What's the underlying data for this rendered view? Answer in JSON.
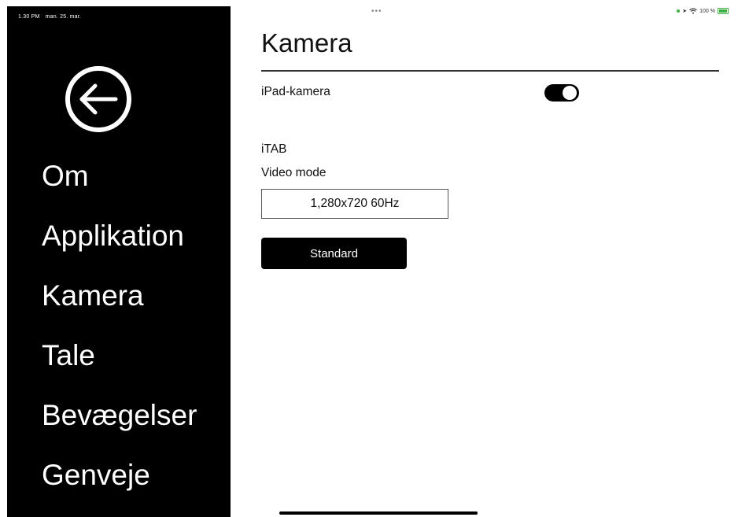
{
  "status_bar": {
    "time": "1.30 PM",
    "date": "man. 25. mar.",
    "multitask": "•••",
    "battery_text": "100 %",
    "wifi_icon": "wifi-icon",
    "location_icon": "location-icon",
    "accent_color": "#3cb043"
  },
  "sidebar": {
    "back_icon": "arrow-left-circle-icon",
    "items": [
      {
        "label": "Om"
      },
      {
        "label": "Applikation"
      },
      {
        "label": "Kamera"
      },
      {
        "label": "Tale"
      },
      {
        "label": "Bevægelser"
      },
      {
        "label": "Genveje"
      }
    ]
  },
  "main": {
    "title": "Kamera",
    "ipad_camera": {
      "label": "iPad-kamera",
      "enabled": true
    },
    "section_label": "iTAB",
    "video_mode": {
      "label": "Video mode",
      "value": "1,280x720 60Hz"
    },
    "standard_button": "Standard"
  }
}
